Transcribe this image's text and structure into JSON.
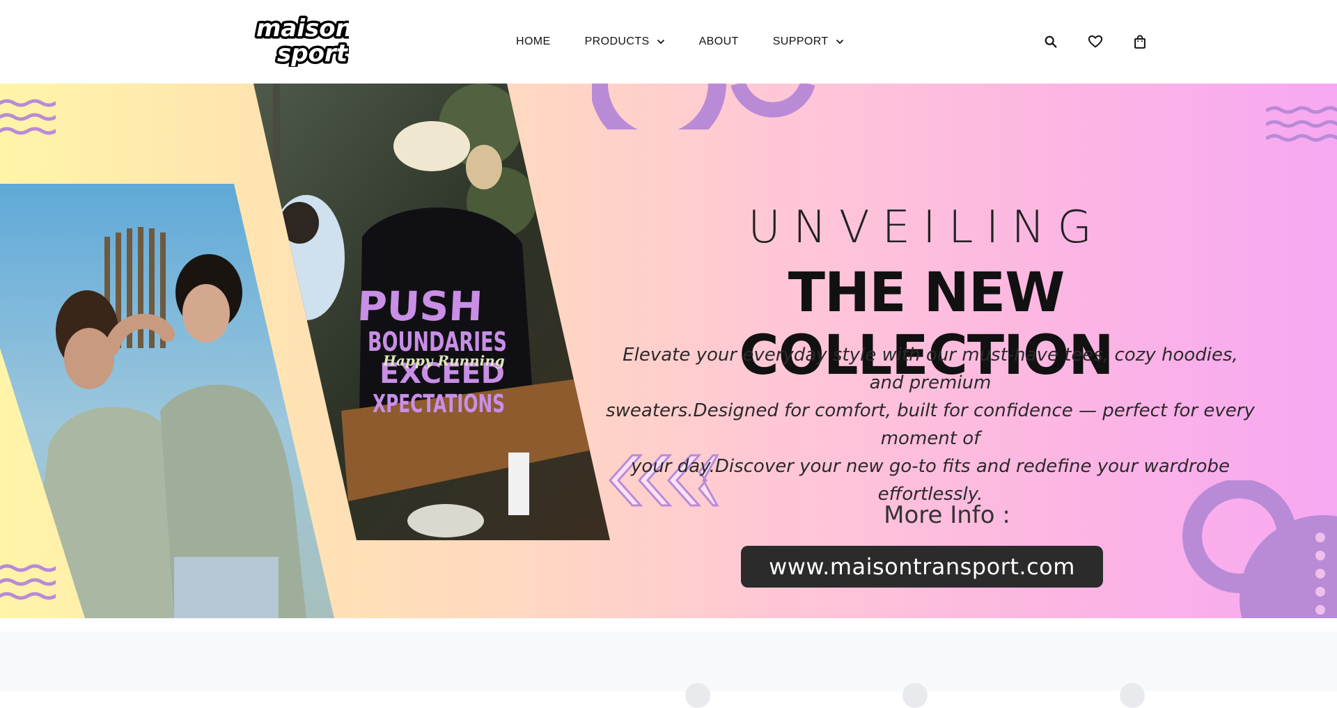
{
  "brand": {
    "logo_line1": "maison",
    "logo_line2": "sport"
  },
  "nav": {
    "items": [
      {
        "label": "HOME",
        "has_dropdown": false
      },
      {
        "label": "PRODUCTS",
        "has_dropdown": true
      },
      {
        "label": "ABOUT",
        "has_dropdown": false
      },
      {
        "label": "SUPPORT",
        "has_dropdown": true
      }
    ]
  },
  "tools": {
    "icons": [
      "search-icon",
      "heart-icon",
      "shopping-bag-icon"
    ]
  },
  "hero": {
    "eyebrow": "UNVEILING",
    "headline": "THE NEW COLLECTION",
    "tagline_lines": [
      "Elevate your everyday style with our must-have tees, cozy hoodies, and premium",
      "sweaters.Designed for comfort, built for confidence — perfect for every moment of",
      "your day.Discover your new go-to fits and redefine your wardrobe effortlessly."
    ],
    "more_info": "More Info :",
    "url": "www.maisontransport.com",
    "shirt_print": {
      "line1": "PUSH",
      "line2": "BOUNDARIES",
      "line3": "EXCEED",
      "line4": "XPECTATIONS",
      "script": "Happy Running"
    }
  },
  "colors": {
    "gradient_start": "#fff4a8",
    "gradient_end": "#f7a8f2",
    "accent_purple": "#b98ad6",
    "button_dark": "#2b2b2b"
  }
}
